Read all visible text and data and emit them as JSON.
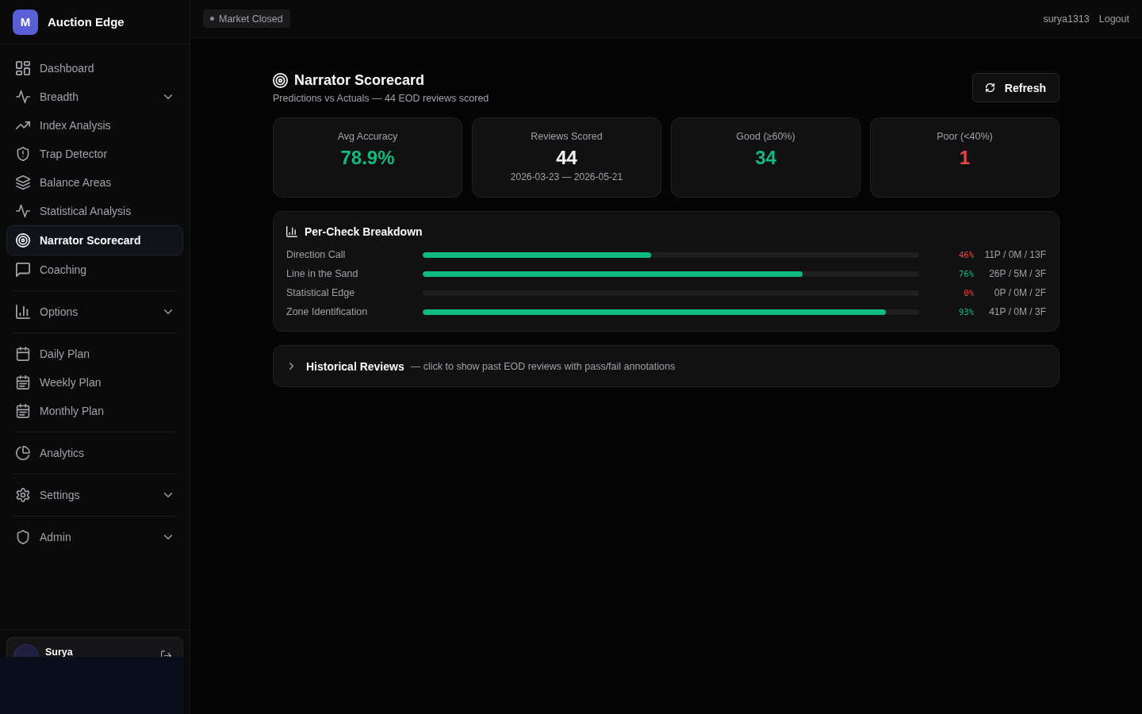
{
  "sidebar": {
    "brand": {
      "logo": "M",
      "name": "Auction Edge"
    },
    "sections": [
      {
        "items": [
          {
            "label": "Dashboard",
            "kind": "link",
            "selected": false
          },
          {
            "label": "Breadth",
            "kind": "group",
            "selected": false,
            "expanded": false
          },
          {
            "label": "Index Analysis",
            "kind": "link",
            "selected": false
          },
          {
            "label": "Trap Detector",
            "kind": "link",
            "selected": false
          },
          {
            "label": "Balance Areas",
            "kind": "link",
            "selected": false
          },
          {
            "label": "Statistical Analysis",
            "kind": "link",
            "selected": false
          },
          {
            "label": "Narrator Scorecard",
            "kind": "link",
            "selected": true
          },
          {
            "label": "Coaching",
            "kind": "link",
            "selected": false
          }
        ]
      },
      {
        "items": [
          {
            "label": "Options",
            "kind": "group",
            "selected": false,
            "expanded": false
          }
        ]
      },
      {
        "items": [
          {
            "label": "Daily Plan",
            "kind": "link",
            "selected": false
          },
          {
            "label": "Weekly Plan",
            "kind": "link",
            "selected": false
          },
          {
            "label": "Monthly Plan",
            "kind": "link",
            "selected": false
          }
        ]
      },
      {
        "items": [
          {
            "label": "Analytics",
            "kind": "link",
            "selected": false
          }
        ]
      },
      {
        "items": [
          {
            "label": "Settings",
            "kind": "group",
            "selected": false,
            "expanded": false
          }
        ]
      },
      {
        "items": [
          {
            "label": "Admin",
            "kind": "group",
            "selected": false,
            "expanded": false
          }
        ]
      }
    ],
    "user": {
      "name": "Surya"
    }
  },
  "header": {
    "market_status": "Market Closed",
    "username": "surya1313",
    "logout": "Logout"
  },
  "page": {
    "title": "Narrator Scorecard",
    "subtitle": "Predictions vs Actuals — 44 EOD reviews scored",
    "refresh_button": "Refresh"
  },
  "stats": [
    {
      "label": "Avg Accuracy",
      "value": "78.9%",
      "color": "#10b981"
    },
    {
      "label": "Reviews Scored",
      "value": "44",
      "color": "#f4f4f5",
      "detail": "2026-03-23 — 2026-05-21"
    },
    {
      "label": "Good (≥60%)",
      "value": "34",
      "color": "#10b981"
    },
    {
      "label": "Poor (<40%)",
      "value": "1",
      "color": "#ef4444"
    }
  ],
  "breakdown": {
    "title": "Per-Check Breakdown",
    "checks": [
      {
        "name": "Direction Call",
        "level": 0.46,
        "percent": "46%",
        "color": "#ef4444",
        "counts": "11P / 0M / 13F"
      },
      {
        "name": "Line in the Sand",
        "level": 0.765,
        "percent": "76%",
        "color": "#10b981",
        "counts": "26P / 5M / 3F"
      },
      {
        "name": "Statistical Edge",
        "percent": "0%",
        "color": "#ef4444",
        "counts": "0P / 0M / 2F"
      },
      {
        "name": "Zone Identification",
        "level": 0.933,
        "percent": "93%",
        "color": "#10b981",
        "counts": "41P / 0M / 3F"
      }
    ]
  },
  "history": {
    "title": "Historical Reviews",
    "hint": "— click to show past EOD reviews with pass/fail annotations",
    "expanded": false
  }
}
